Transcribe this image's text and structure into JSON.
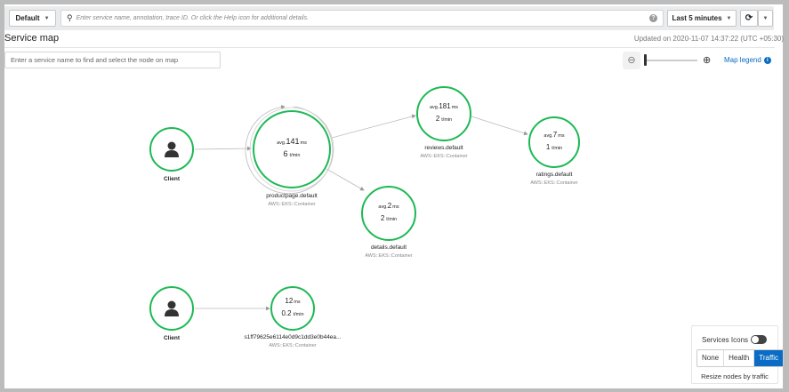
{
  "toolbar": {
    "group": "Default",
    "search_placeholder": "Enter service name, annotation, trace ID. Or click the Help icon for additional details.",
    "time_range": "Last 5 minutes"
  },
  "header": {
    "title": "Service map",
    "updated": "Updated on 2020-11-07 14:37:22 (UTC +05:30)"
  },
  "find": {
    "placeholder": "Enter a service name to find and select the node on map"
  },
  "map_legend": "Map legend",
  "nodes": [
    {
      "name": "Client"
    },
    {
      "name": "productpage.default",
      "type": "AWS::EKS::Container",
      "prefix": "avg.",
      "latency": "141",
      "latency_unit": "ms",
      "rate": "6",
      "rate_unit": "t/min"
    },
    {
      "name": "reviews.default",
      "type": "AWS::EKS::Container",
      "prefix": "avg.",
      "latency": "181",
      "latency_unit": "ms",
      "rate": "2",
      "rate_unit": "t/min"
    },
    {
      "name": "ratings.default",
      "type": "AWS::EKS::Container",
      "prefix": "avg.",
      "latency": "7",
      "latency_unit": "ms",
      "rate": "1",
      "rate_unit": "t/min"
    },
    {
      "name": "details.default",
      "type": "AWS::EKS::Container",
      "prefix": "avg.",
      "latency": "2",
      "latency_unit": "ms",
      "rate": "2",
      "rate_unit": "t/min"
    },
    {
      "name": "Client"
    },
    {
      "name": "s1ff79625e6114e0d9c1dd3e0b44ea...",
      "type": "AWS::EKS::Container",
      "prefix": "",
      "latency": "12",
      "latency_unit": "ms",
      "rate": "0.2",
      "rate_unit": "t/min"
    }
  ],
  "panel": {
    "services_icons": "Services Icons",
    "options": [
      "None",
      "Health",
      "Traffic"
    ],
    "selected": "Traffic",
    "footer": "Resize nodes by traffic"
  },
  "colors": {
    "node": "#1db954",
    "accent": "#0a6cc4"
  }
}
